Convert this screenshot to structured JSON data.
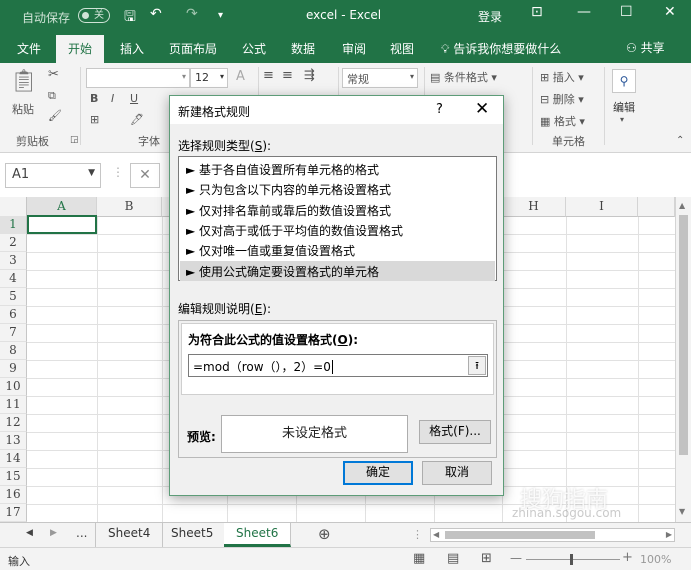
{
  "titlebar": {
    "autosave_label": "自动保存",
    "autosave_toggle": "关",
    "title": "excel  -  Excel",
    "login": "登录",
    "colors": {
      "brand": "#217346"
    }
  },
  "ribbon_tabs": {
    "items": [
      "文件",
      "开始",
      "插入",
      "页面布局",
      "公式",
      "数据",
      "审阅",
      "视图"
    ],
    "active": "开始",
    "tell_me": "告诉我你想要做什么",
    "share": "共享"
  },
  "ribbon": {
    "paste_label": "粘贴",
    "clipboard_group": "剪贴板",
    "font_group": "字体",
    "font_size": "12",
    "number_format": "常规",
    "conditional_format": "条件格式",
    "insert": "插入",
    "delete": "删除",
    "format": "格式",
    "cells_group": "单元格",
    "edit_label": "编辑"
  },
  "formula_bar": {
    "name_box": "A1",
    "cancel_symbol": "✕"
  },
  "grid": {
    "columns": [
      "A",
      "B",
      "H",
      "I"
    ],
    "rows": [
      "1",
      "2",
      "3",
      "4",
      "5",
      "6",
      "7",
      "8",
      "9",
      "10",
      "11",
      "12",
      "13",
      "14",
      "15",
      "16",
      "17"
    ]
  },
  "sheet_tabs": {
    "ellipsis": "...",
    "tabs": [
      "Sheet4",
      "Sheet5",
      "Sheet6"
    ],
    "active": "Sheet6",
    "add_symbol": "⊕"
  },
  "statusbar": {
    "mode": "输入",
    "zoom": "100%"
  },
  "dialog": {
    "title": "新建格式规则",
    "help": "?",
    "close": "✕",
    "select_type_label": "选择规则类型(",
    "select_type_key": "S",
    "select_type_end": "):",
    "rule_types": [
      "► 基于各自值设置所有单元格的格式",
      "► 只为包含以下内容的单元格设置格式",
      "► 仅对排名靠前或靠后的数值设置格式",
      "► 仅对高于或低于平均值的数值设置格式",
      "► 仅对唯一值或重复值设置格式",
      "► 使用公式确定要设置格式的单元格"
    ],
    "selected_index": 5,
    "edit_desc_label": "编辑规则说明(",
    "edit_desc_key": "E",
    "edit_desc_end": "):",
    "formula_heading": "为符合此公式的值设置格式(",
    "formula_heading_key": "O",
    "formula_heading_end": "):",
    "formula_value": "=mod（row（），2）=0",
    "preview_label": "预览:",
    "preview_text": "未设定格式",
    "format_button": "格式(F)...",
    "ok_button": "确定",
    "cancel_button": "取消"
  },
  "watermark": {
    "text": "搜狗指南",
    "url": "zhinan.sogou.com"
  }
}
